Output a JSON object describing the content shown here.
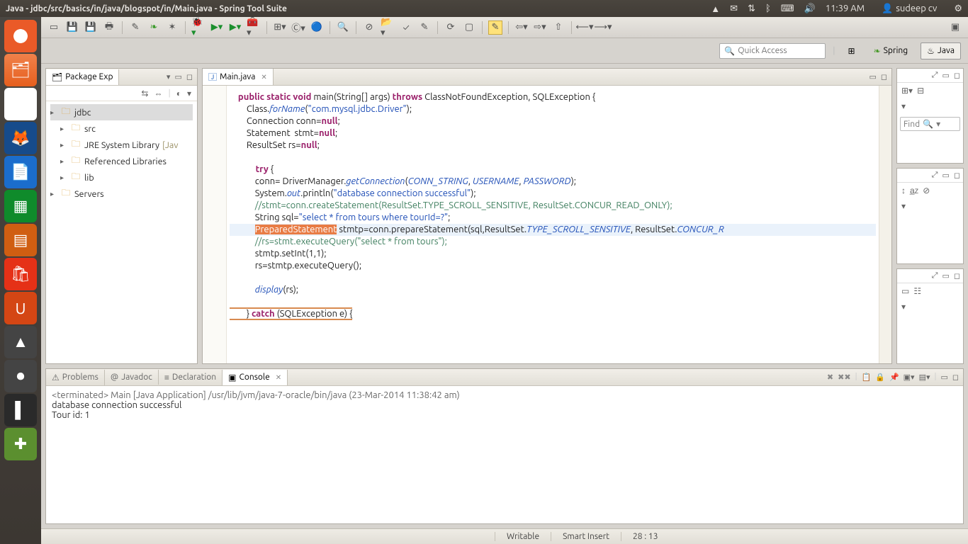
{
  "panel": {
    "title": "Java - jdbc/src/basics/in/java/blogspot/in/Main.java - Spring Tool Suite",
    "time": "11:39 AM",
    "user": "sudeep cv"
  },
  "persp": {
    "quick": "Quick Access",
    "spring": "Spring",
    "java": "Java"
  },
  "pkg": {
    "title": "Package Exp",
    "items": [
      {
        "label": "jdbc",
        "sel": true,
        "lvl": 1
      },
      {
        "label": "src",
        "lvl": 2
      },
      {
        "label": "JRE System Library",
        "suffix": "[Jav",
        "lvl": 2
      },
      {
        "label": "Referenced Libraries",
        "lvl": 2
      },
      {
        "label": "lib",
        "lvl": 2
      },
      {
        "label": "Servers",
        "lvl": 1
      }
    ]
  },
  "editor": {
    "tab": "Main.java"
  },
  "code": {
    "l1a": "public static void",
    "l1b": " main(String[] args) ",
    "l1c": "throws",
    "l1d": " ClassNotFoundException, SQLException {",
    "l2a": "        Class.",
    "l2b": "forName",
    "l2c": "(",
    "l2d": "\"com.mysql.jdbc.Driver\"",
    "l2e": ");",
    "l3a": "        Connection conn=",
    "l3b": "null",
    "l3c": ";",
    "l4a": "        Statement  stmt=",
    "l4b": "null",
    "l4c": ";",
    "l5a": "        ResultSet rs=",
    "l5b": "null",
    "l5c": ";",
    "l6": "",
    "l7a": "        try",
    "l7b": " {",
    "l8a": "            conn= DriverManager.",
    "l8b": "getConnection",
    "l8c": "(",
    "l8d": "CONN_STRING",
    "l8e": ", ",
    "l8f": "USERNAME",
    "l8g": ", ",
    "l8h": "PASSWORD",
    "l8i": ");",
    "l9a": "            System.",
    "l9b": "out",
    "l9c": ".println(",
    "l9d": "\"database connection successful\"",
    "l9e": ");",
    "l10": "            //stmt=conn.createStatement(ResultSet.TYPE_SCROLL_SENSITIVE, ResultSet.CONCUR_READ_ONLY);",
    "l11a": "            String sql=",
    "l11b": "\"select * from tours where tourId=?\"",
    "l11c": ";",
    "l12a": "            ",
    "l12b": "PreparedStatement",
    "l12c": " stmtp=conn.prepareStatement(sql,ResultSet.",
    "l12d": "TYPE_SCROLL_SENSITIVE",
    "l12e": ", ResultSet.",
    "l12f": "CONCUR_R",
    "l13": "            //rs=stmt.executeQuery(\"select * from tours\");",
    "l14": "            stmtp.setInt(1,1);",
    "l15": "            rs=stmtp.executeQuery();",
    "l16": "",
    "l17a": "            ",
    "l17b": "display",
    "l17c": "(rs);",
    "l18": "",
    "l19a": "        } ",
    "l19b": "catch",
    "l19c": " (SQLException e) {"
  },
  "tabs": {
    "problems": "Problems",
    "javadoc": "Javadoc",
    "declaration": "Declaration",
    "console": "Console"
  },
  "console": {
    "header": "<terminated> Main [Java Application] /usr/lib/jvm/java-7-oracle/bin/java (23-Mar-2014 11:38:42 am)",
    "line1": "database connection successful",
    "line2": "Tour id: 1"
  },
  "find": "Find",
  "status": {
    "writable": "Writable",
    "insert": "Smart Insert",
    "pos": "28 : 13"
  }
}
